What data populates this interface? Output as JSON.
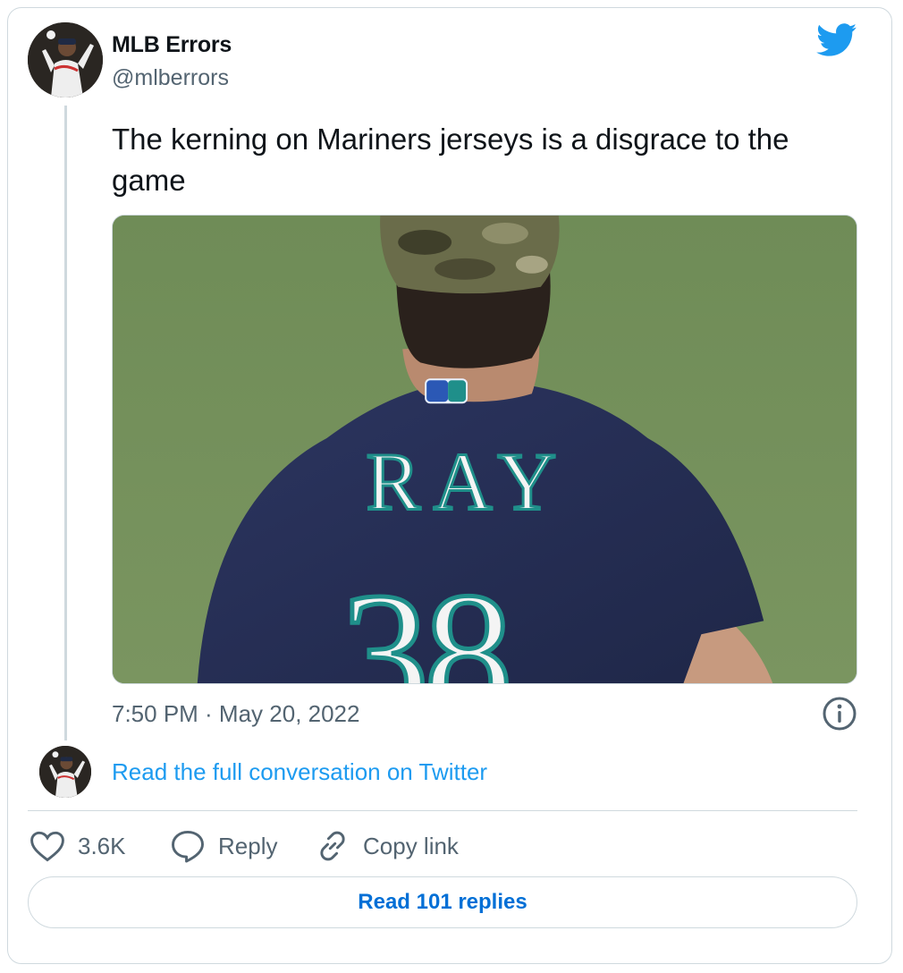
{
  "author": {
    "name": "MLB Errors",
    "handle": "@mlberrors",
    "avatar_icon": "baseball-player-avatar"
  },
  "brand": {
    "icon": "twitter-bird-icon",
    "color": "#1d9bf0"
  },
  "tweet": {
    "text": "The kerning on Mariners jerseys is a disgrace to the game",
    "timestamp": "7:50 PM · May 20, 2022"
  },
  "media": {
    "jersey_name": "RAY",
    "jersey_number": "38"
  },
  "conversation": {
    "link_label": "Read the full conversation on Twitter"
  },
  "actions": {
    "like_count": "3.6K",
    "reply_label": "Reply",
    "copy_label": "Copy link"
  },
  "replies_button": {
    "label": "Read 101 replies"
  },
  "colors": {
    "link": "#1d9bf0",
    "button_text": "#006fd6",
    "secondary_text": "#536471",
    "border": "#cfd9de"
  }
}
